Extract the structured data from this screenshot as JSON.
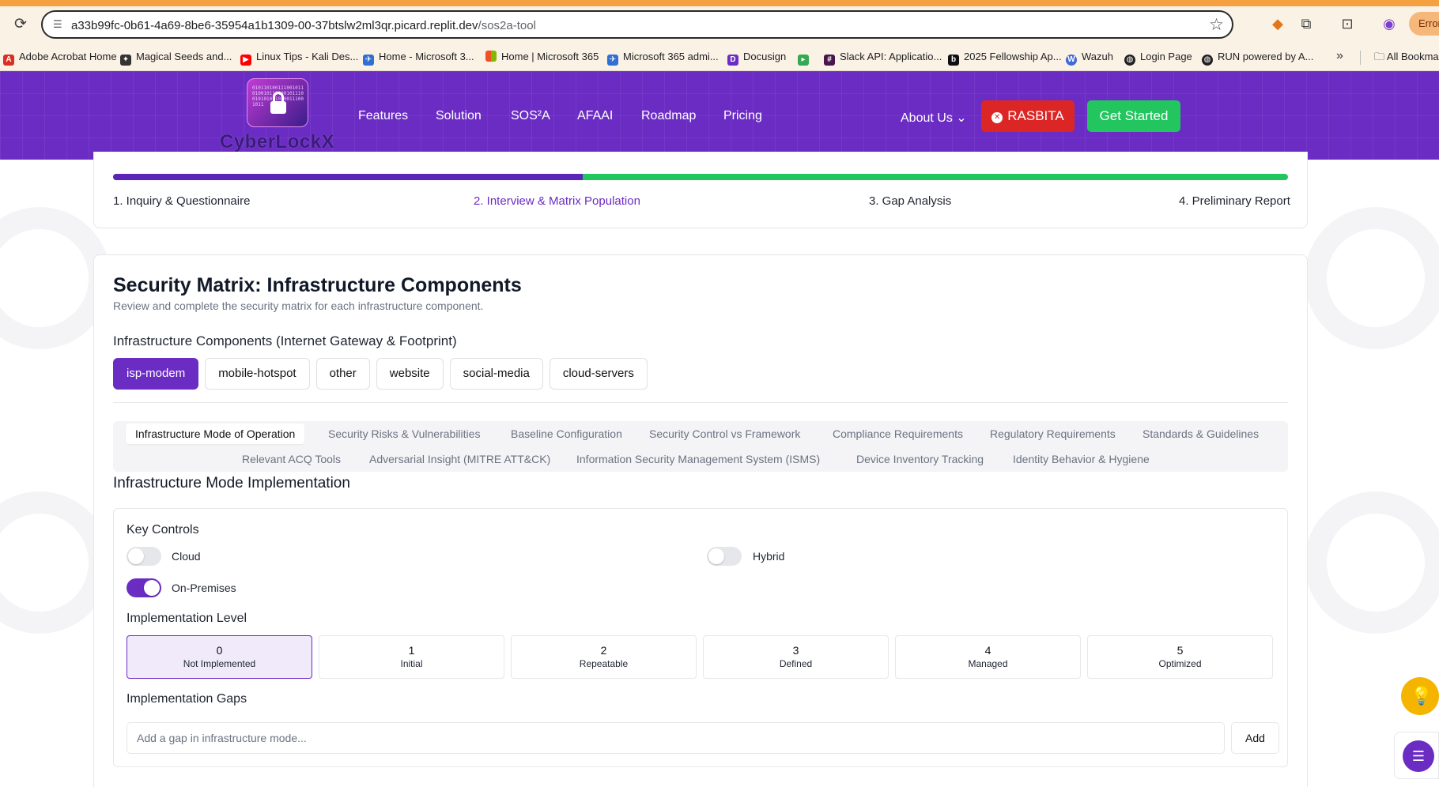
{
  "browser": {
    "url_host": "a33b99fc-0b61-4a69-8be6-35954a1b1309-00-37btslw2ml3qr.picard.replit.dev",
    "url_path": "/sos2a-tool",
    "error_label": "Error",
    "bookmarks": [
      {
        "label": "Adobe Acrobat Home",
        "color": "#d93025"
      },
      {
        "label": "Magical Seeds and...",
        "color": "#333333"
      },
      {
        "label": "Linux Tips - Kali Des...",
        "color": "#ff0000"
      },
      {
        "label": "Home - Microsoft 3...",
        "color": "#2f6fd6"
      },
      {
        "label": "Home | Microsoft 365",
        "color": "#f25022"
      },
      {
        "label": "Microsoft 365 admi...",
        "color": "#2f6fd6"
      },
      {
        "label": "Docusign",
        "color": "#6b2cc4"
      },
      {
        "label": "Slack API: Applicatio...",
        "color": "#4a154b"
      },
      {
        "label": "2025 Fellowship Ap...",
        "color": "#111111"
      },
      {
        "label": "Wazuh",
        "color": "#3f6ad8"
      },
      {
        "label": "Login Page",
        "color": "#222222"
      },
      {
        "label": "RUN powered by A...",
        "color": "#222222"
      }
    ],
    "all_bookmarks": "All Bookmarks"
  },
  "header": {
    "logo_text": "CyberLockX",
    "logo_bits": "0101101001110010110100101101001011100101010110100111001011",
    "nav": [
      "Features",
      "Solution",
      "SOS²A",
      "AFAAI",
      "Roadmap",
      "Pricing"
    ],
    "about": "About Us",
    "rasbita": "RASBITA",
    "get_started": "Get Started"
  },
  "progress": {
    "completion": 0.4,
    "steps": [
      "1. Inquiry & Questionnaire",
      "2. Interview & Matrix Population",
      "3. Gap Analysis",
      "4. Preliminary Report"
    ],
    "active_step": 1
  },
  "matrix": {
    "title": "Security Matrix: Infrastructure Components",
    "subtitle": "Review and complete the security matrix for each infrastructure component.",
    "components_label": "Infrastructure Components (Internet Gateway & Footprint)",
    "components": [
      "isp-modem",
      "mobile-hotspot",
      "other",
      "website",
      "social-media",
      "cloud-servers"
    ],
    "active_component": 0,
    "tabs": [
      "Infrastructure Mode of Operation",
      "Security Risks & Vulnerabilities",
      "Baseline Configuration",
      "Security Control vs Framework",
      "Compliance Requirements",
      "Regulatory Requirements",
      "Standards & Guidelines",
      "Relevant ACQ Tools",
      "Adversarial Insight (MITRE ATT&CK)",
      "Information Security Management System (ISMS)",
      "Device Inventory Tracking",
      "Identity Behavior & Hygiene"
    ],
    "implementation": {
      "title": "Infrastructure Mode Implementation",
      "key_controls_label": "Key Controls",
      "controls": [
        {
          "label": "Cloud",
          "on": false
        },
        {
          "label": "Hybrid",
          "on": false
        },
        {
          "label": "On-Premises",
          "on": true
        }
      ],
      "level_label": "Implementation Level",
      "levels": [
        {
          "num": "0",
          "name": "Not Implemented"
        },
        {
          "num": "1",
          "name": "Initial"
        },
        {
          "num": "2",
          "name": "Repeatable"
        },
        {
          "num": "3",
          "name": "Defined"
        },
        {
          "num": "4",
          "name": "Managed"
        },
        {
          "num": "5",
          "name": "Optimized"
        }
      ],
      "selected_level": 0,
      "gaps_label": "Implementation Gaps",
      "gap_placeholder": "Add a gap in infrastructure mode...",
      "add_label": "Add"
    }
  },
  "colors": {
    "brand_purple": "#6b2cc4",
    "progress_green": "#22c55e",
    "danger_red": "#dc2626"
  }
}
